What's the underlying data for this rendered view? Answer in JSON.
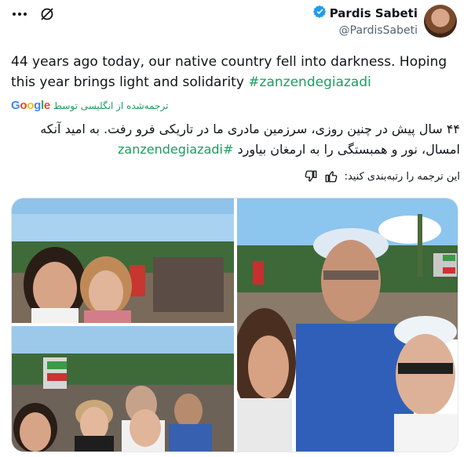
{
  "author": {
    "name": "Pardis Sabeti",
    "handle": "@PardisSabeti",
    "verified_color": "#1d9bf0"
  },
  "tweet": {
    "text_main": "44 years ago today, our native country fell into darkness. Hoping this year brings light and solidarity ",
    "hashtag": "#zanzendegiazadi"
  },
  "translation": {
    "provider_letters": [
      "G",
      "o",
      "o",
      "g",
      "l",
      "e"
    ],
    "provider_colors": [
      "#4285f4",
      "#ea4335",
      "#fbbc05",
      "#4285f4",
      "#34a853",
      "#ea4335"
    ],
    "label": "ترجمه‌شده از انگلیسی توسط",
    "text_main": "۴۴ سال پیش در چنین روزی، سرزمین مادری ما در تاریکی فرو رفت. به امید آنکه امسال، نور و همبستگی را به ارمغان بیاورد ",
    "hashtag": "#zanzendegiazadi",
    "rate_label": "این ترجمه را رتبه‌بندی کنید:"
  },
  "colors": {
    "hashtag": "#1a9e5f",
    "text": "#0f1419",
    "muted": "#536471"
  },
  "icons": {
    "more": "more-dots-icon",
    "grok": "grok-slash-icon",
    "verified": "verified-badge-icon",
    "thumb_up": "thumb-up-icon",
    "thumb_down": "thumb-down-icon"
  }
}
